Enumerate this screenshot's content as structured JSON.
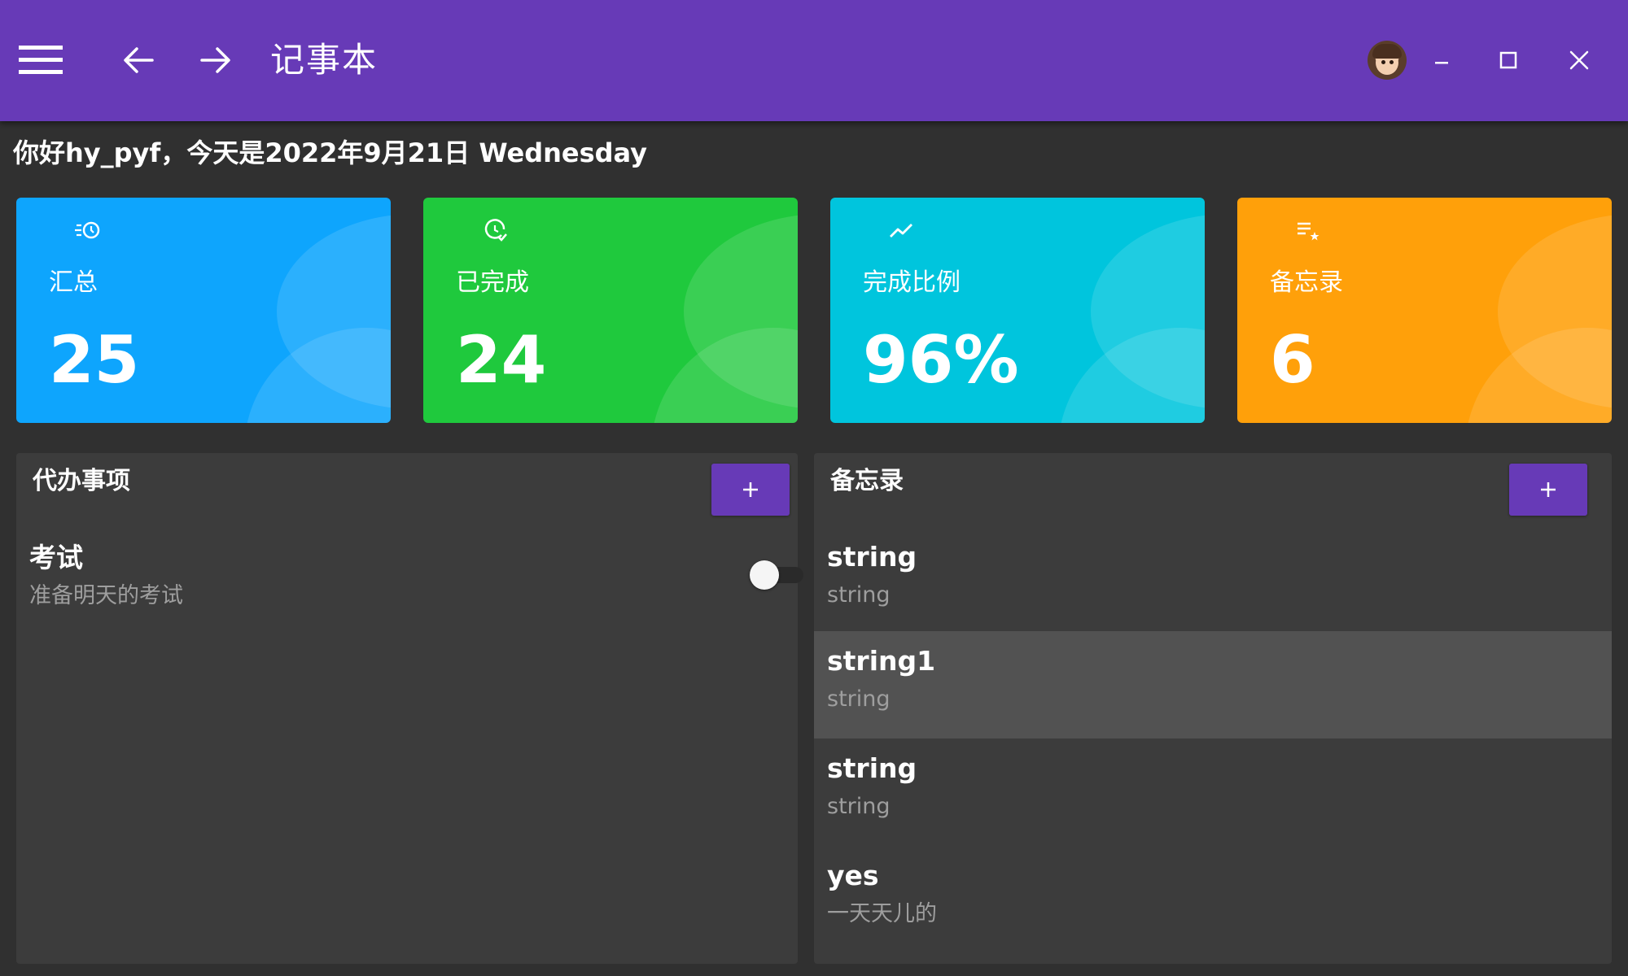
{
  "header": {
    "title": "记事本",
    "icons": {
      "menu": "menu-icon",
      "back": "arrow-left-icon",
      "forward": "arrow-right-icon",
      "minimize": "minimize-icon",
      "maximize": "maximize-icon",
      "close": "close-icon"
    },
    "color": "#673ab7"
  },
  "greeting": "你好hy_pyf，今天是2022年9月21日 Wednesday",
  "stats": [
    {
      "label": "汇总",
      "value": "25",
      "color": "#0ea5fd",
      "icon": "history-icon"
    },
    {
      "label": "已完成",
      "value": "24",
      "color": "#1fc93d",
      "icon": "clock-check-icon"
    },
    {
      "label": "完成比例",
      "value": "96%",
      "color": "#00c5dd",
      "icon": "trend-icon"
    },
    {
      "label": "备忘录",
      "value": "6",
      "color": "#ffa00a",
      "icon": "playlist-star-icon"
    }
  ],
  "todo": {
    "title": "代办事项",
    "add_label": "+",
    "items": [
      {
        "title": "考试",
        "subtitle": "准备明天的考试",
        "done": false
      }
    ]
  },
  "memo": {
    "title": "备忘录",
    "add_label": "+",
    "items": [
      {
        "title": "string",
        "subtitle": "string"
      },
      {
        "title": "string1",
        "subtitle": "string"
      },
      {
        "title": "string",
        "subtitle": "string"
      },
      {
        "title": "yes",
        "subtitle": "一天天儿的"
      }
    ]
  }
}
